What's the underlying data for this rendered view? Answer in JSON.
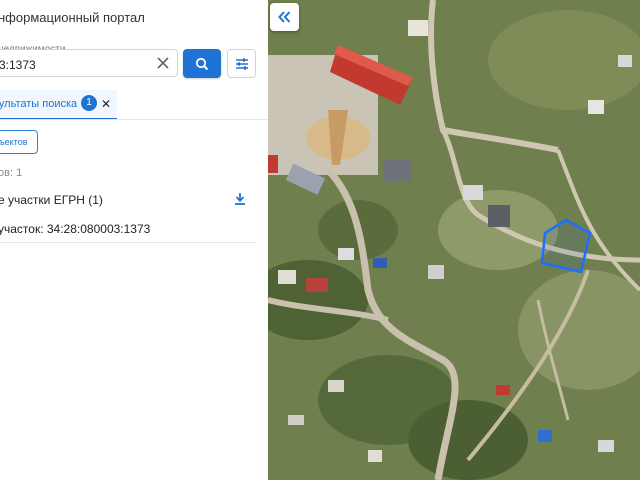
{
  "header": {
    "title": "нформационный портал"
  },
  "search": {
    "label": "недвижимости",
    "value": "3:1373"
  },
  "tabs": [
    {
      "label": "зультаты поиска",
      "badge": "1"
    }
  ],
  "objects_button": {
    "label": "ъектов"
  },
  "results": {
    "count_text": "ов: 1",
    "group_title": "е участки ЕГРН (1)",
    "items": [
      {
        "text": "участок: 34:28:080003:1373"
      }
    ]
  },
  "icons": {
    "search": "search-icon",
    "filter": "sliders-icon",
    "clear": "close-icon",
    "download": "download-icon",
    "collapse": "double-chevron-left-icon"
  },
  "colors": {
    "accent": "#1f73d6",
    "parcel_outline": "#1e6fff"
  }
}
